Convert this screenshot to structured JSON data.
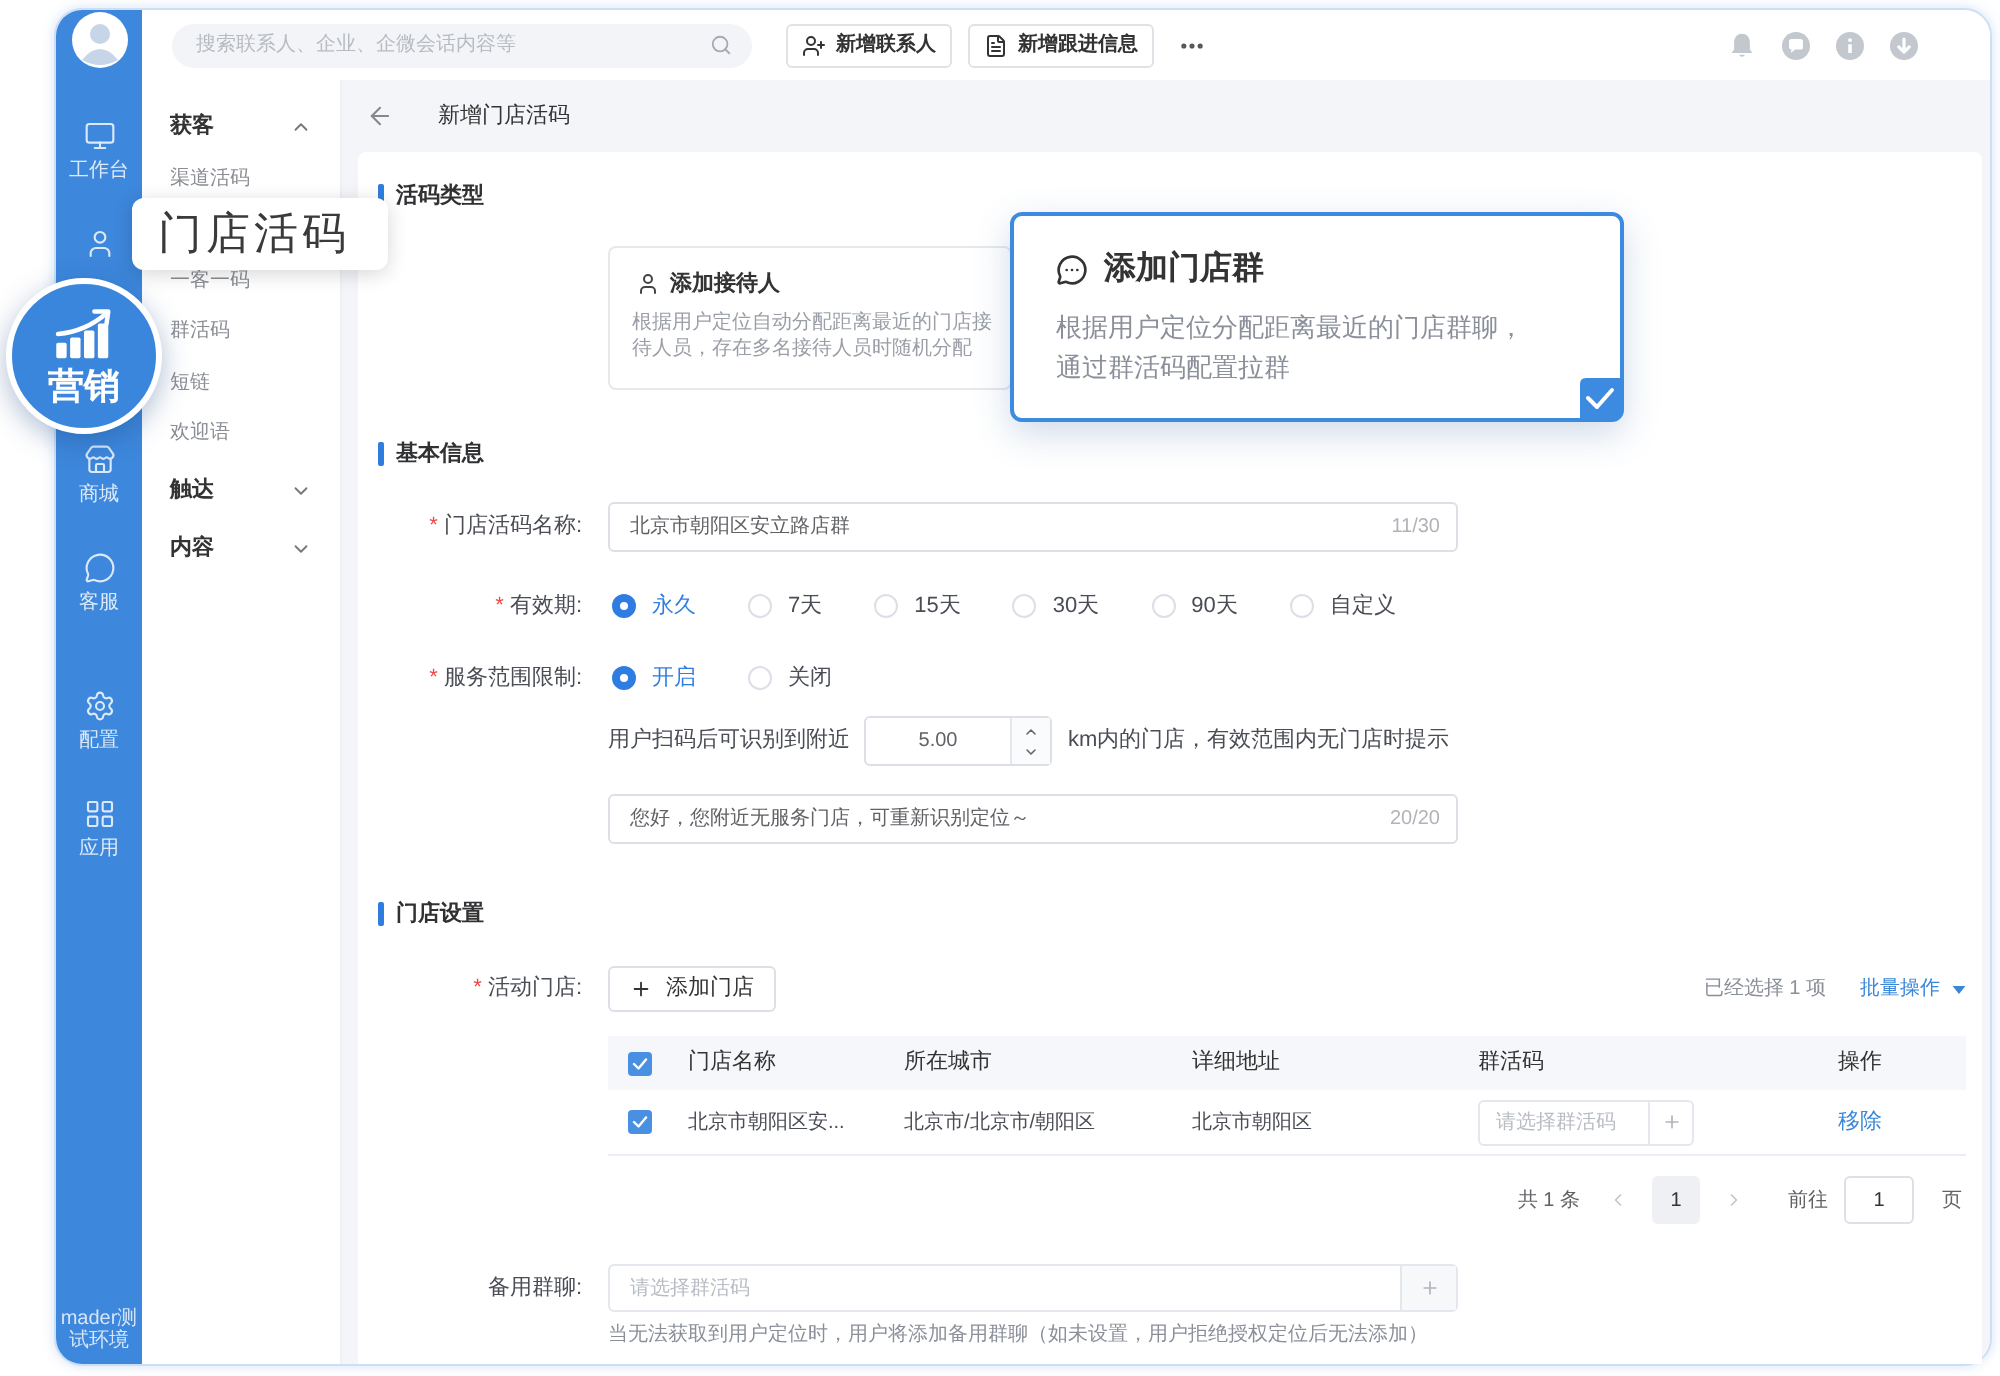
{
  "sidebar": {
    "items": [
      {
        "label": "工作台",
        "selected": false
      },
      {
        "selected": false
      },
      {
        "label": "营销",
        "selected": true
      },
      {
        "label": "商城",
        "selected": false
      },
      {
        "label": "客服",
        "selected": false
      }
    ],
    "bottom_items": [
      {
        "label": "配置",
        "selected": false
      },
      {
        "label": "应用",
        "selected": false
      }
    ],
    "footer": "mader测试环境"
  },
  "top_bar": {
    "search": {
      "placeholder": "搜索联系人、企业、企微会话内容等"
    },
    "buttons": [
      "新增联系人",
      "新增跟进信息"
    ]
  },
  "menu": [
    {
      "label": "获客",
      "expanded": true,
      "children": [
        {
          "label": "渠道活码",
          "selected": false
        },
        {
          "label": "门店活码",
          "selected": true
        },
        {
          "label": "一客一码",
          "selected": false
        },
        {
          "label": "群活码",
          "selected": false
        },
        {
          "label": "短链",
          "selected": false
        },
        {
          "label": "欢迎语",
          "selected": false
        }
      ]
    },
    {
      "label": "触达",
      "expanded": false
    },
    {
      "label": "内容",
      "expanded": false
    }
  ],
  "page": {
    "title": "新增门店活码"
  },
  "code_type": {
    "title": "活码类型",
    "options": [
      {
        "title": "添加接待人",
        "description": "根据用户定位自动分配距离最近的门店接待人员，存在多名接待人员时随机分配",
        "selected": false
      },
      {
        "title": "添加门店群",
        "description": "根据用户定位分配距离最近的门店群聊，通过群活码配置拉群",
        "selected": true
      }
    ]
  },
  "basic_info": {
    "title": "基本信息",
    "name": {
      "mark": "*",
      "label": "门店活码名称:",
      "value": "北京市朝阳区安立路店群",
      "count": "11/30"
    },
    "validity": {
      "mark": "*",
      "label": "有效期:",
      "options": [
        {
          "label": "永久",
          "selected": true
        },
        {
          "label": "7天",
          "selected": false
        },
        {
          "label": "15天",
          "selected": false
        },
        {
          "label": "30天",
          "selected": false
        },
        {
          "label": "90天",
          "selected": false
        },
        {
          "label": "自定义",
          "selected": false
        }
      ]
    },
    "service_range": {
      "mark": "*",
      "label": "服务范围限制:",
      "options": [
        {
          "label": "开启",
          "selected": true
        },
        {
          "label": "关闭",
          "selected": false
        }
      ]
    },
    "radius": {
      "prefix": "用户扫码后可识别到附近",
      "value": "5.00",
      "suffix": "km内的门店，有效范围内无门店时提示"
    },
    "tip": {
      "value": "您好，您附近无服务门店，可重新识别定位～",
      "count": "20/20"
    }
  },
  "store_settings": {
    "title": "门店设置",
    "active_stores": {
      "mark": "*",
      "label": "活动门店:",
      "add_button": "添加门店",
      "selection_info": "已经选择 1 项",
      "batch_action": "批量操作"
    },
    "table": {
      "all_selected": true,
      "columns": [
        "门店名称",
        "所在城市",
        "详细地址",
        "群活码",
        "操作"
      ],
      "rows": [
        {
          "selected": true,
          "store_name": "北京市朝阳区安...",
          "city": "北京市/北京市/朝阳区",
          "address": "北京市朝阳区",
          "group_code_placeholder": "请选择群活码",
          "action": "移除"
        }
      ]
    },
    "pagination": {
      "total": "共 1 条",
      "pages": [
        {
          "label": "1",
          "selected": true
        }
      ],
      "goto_label": "前往",
      "goto_value": "1",
      "goto_suffix": "页"
    },
    "backup_group": {
      "label": "备用群聊:",
      "placeholder": "请选择群活码",
      "hint": "当无法获取到用户定位时，用户将添加备用群聊（如未设置，用户拒绝授权定位后无法添加）"
    }
  }
}
